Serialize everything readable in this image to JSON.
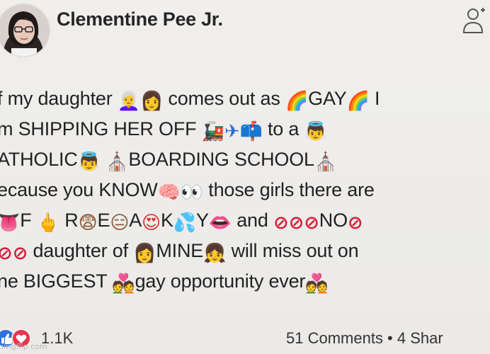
{
  "post": {
    "author": "Clementine Pee Jr.",
    "lines": [
      [
        {
          "t": "text",
          "v": "f my daughter "
        },
        {
          "t": "emoji",
          "v": "👩‍🦳",
          "c": "e-gray"
        },
        {
          "t": "emoji",
          "v": "👩",
          "c": "e-brown"
        },
        {
          "t": "text",
          "v": " comes out as "
        },
        {
          "t": "emoji",
          "v": "🌈",
          "c": "e-rainbow"
        },
        {
          "t": "text",
          "v": "GAY"
        },
        {
          "t": "emoji",
          "v": "🌈",
          "c": "e-rainbow"
        },
        {
          "t": "text",
          "v": " I"
        }
      ],
      [
        {
          "t": "text",
          "v": "m SHIPPING HER OFF "
        },
        {
          "t": "emoji",
          "v": "🚂",
          "c": "e-red"
        },
        {
          "t": "emoji",
          "v": "✈",
          "c": "e-blue"
        },
        {
          "t": "emoji",
          "v": "📫",
          "c": "e-blue"
        },
        {
          "t": "text",
          "v": " to a "
        },
        {
          "t": "emoji",
          "v": "👼",
          "c": "e-brown"
        }
      ],
      [
        {
          "t": "text",
          "v": "ATHOLIC"
        },
        {
          "t": "emoji",
          "v": "👼",
          "c": "e-brown"
        },
        {
          "t": "text",
          "v": " "
        },
        {
          "t": "emoji",
          "v": "⛪",
          "c": "e-gray"
        },
        {
          "t": "text",
          "v": "BOARDING SCHOOL"
        },
        {
          "t": "emoji",
          "v": "⛪",
          "c": "e-gray"
        }
      ],
      [
        {
          "t": "text",
          "v": "ecause you KNOW"
        },
        {
          "t": "emoji",
          "v": "🧠",
          "c": "e-pink"
        },
        {
          "t": "emoji",
          "v": "👀",
          "c": "e-gray"
        },
        {
          "t": "text",
          "v": " those girls there are"
        }
      ],
      [
        {
          "t": "emoji",
          "v": "👅",
          "c": "e-red"
        },
        {
          "t": "text",
          "v": "F "
        },
        {
          "t": "emoji",
          "v": "🖕",
          "c": "e-brown"
        },
        {
          "t": "text",
          "v": " R"
        },
        {
          "t": "emoji",
          "v": "😨",
          "c": "e-brown"
        },
        {
          "t": "text",
          "v": "E"
        },
        {
          "t": "emoji",
          "v": "😑",
          "c": "e-brown"
        },
        {
          "t": "text",
          "v": "A"
        },
        {
          "t": "emoji",
          "v": "😍",
          "c": "e-red"
        },
        {
          "t": "text",
          "v": "K"
        },
        {
          "t": "emoji",
          "v": "💦",
          "c": "e-blue"
        },
        {
          "t": "text",
          "v": "Y"
        },
        {
          "t": "emoji",
          "v": "👄",
          "c": "e-red"
        },
        {
          "t": "text",
          "v": " and "
        },
        {
          "t": "emoji",
          "v": "⊘",
          "c": "e-ban"
        },
        {
          "t": "emoji",
          "v": "⊘",
          "c": "e-ban"
        },
        {
          "t": "emoji",
          "v": "⊘",
          "c": "e-ban"
        },
        {
          "t": "text",
          "v": "NO"
        },
        {
          "t": "emoji",
          "v": "⊘",
          "c": "e-ban"
        }
      ],
      [
        {
          "t": "emoji",
          "v": "⊘",
          "c": "e-ban"
        },
        {
          "t": "emoji",
          "v": "⊘",
          "c": "e-ban"
        },
        {
          "t": "text",
          "v": " daughter of "
        },
        {
          "t": "emoji",
          "v": "👩",
          "c": "e-gray"
        },
        {
          "t": "text",
          "v": "MINE"
        },
        {
          "t": "emoji",
          "v": "👧",
          "c": "e-gray"
        },
        {
          "t": "text",
          "v": " will miss out on"
        }
      ],
      [
        {
          "t": "text",
          "v": "ne BIGGEST "
        },
        {
          "t": "emoji",
          "v": "💑",
          "c": "e-brown"
        },
        {
          "t": "text",
          "v": "gay opportunity ever"
        },
        {
          "t": "emoji",
          "v": "💑",
          "c": "e-brown"
        }
      ]
    ]
  },
  "footer": {
    "reaction_count": "1.1K",
    "comment_stats": "51 Comments • 4 Shar"
  },
  "watermark": "imgflip.com",
  "colors": {
    "background": "#ecebe9",
    "text": "#222222",
    "like_blue": "#2f6fe0",
    "love_red": "#e8344e"
  }
}
